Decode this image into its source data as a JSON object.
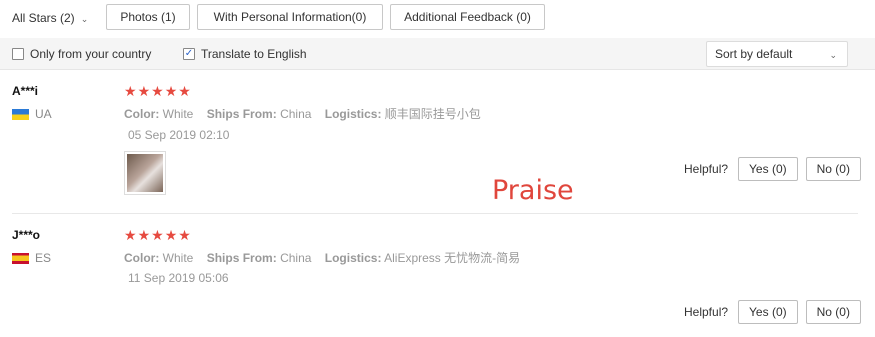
{
  "filters": {
    "stars_select": "All Stars (2)",
    "buttons": [
      {
        "label": "Photos (1)"
      },
      {
        "label": "With Personal Information(0)"
      },
      {
        "label": "Additional Feedback (0)"
      }
    ]
  },
  "options": {
    "only_country": {
      "label": "Only from your country",
      "checked": false
    },
    "translate": {
      "label": "Translate to English",
      "checked": true
    },
    "sort": {
      "value": "Sort by default"
    }
  },
  "reviews": [
    {
      "user": "A***i",
      "country": "UA",
      "rating": 5,
      "color_key": "Color:",
      "color_val": "White",
      "ships_key": "Ships From:",
      "ships_val": "China",
      "logistics_key": "Logistics:",
      "logistics_val": "顺丰国际挂号小包",
      "date": "05 Sep 2019 02:10",
      "has_photo": true,
      "helpful_label": "Helpful?",
      "yes": "Yes (0)",
      "no": "No (0)"
    },
    {
      "user": "J***o",
      "country": "ES",
      "rating": 5,
      "color_key": "Color:",
      "color_val": "White",
      "ships_key": "Ships From:",
      "ships_val": "China",
      "logistics_key": "Logistics:",
      "logistics_val": "AliExpress 无忧物流-简易",
      "date": "11 Sep 2019 05:06",
      "has_photo": false,
      "helpful_label": "Helpful?",
      "yes": "Yes (0)",
      "no": "No (0)"
    }
  ],
  "overlay_text": "Praise",
  "colors": {
    "star": "#e64a40",
    "overlay": "#e0463c"
  }
}
